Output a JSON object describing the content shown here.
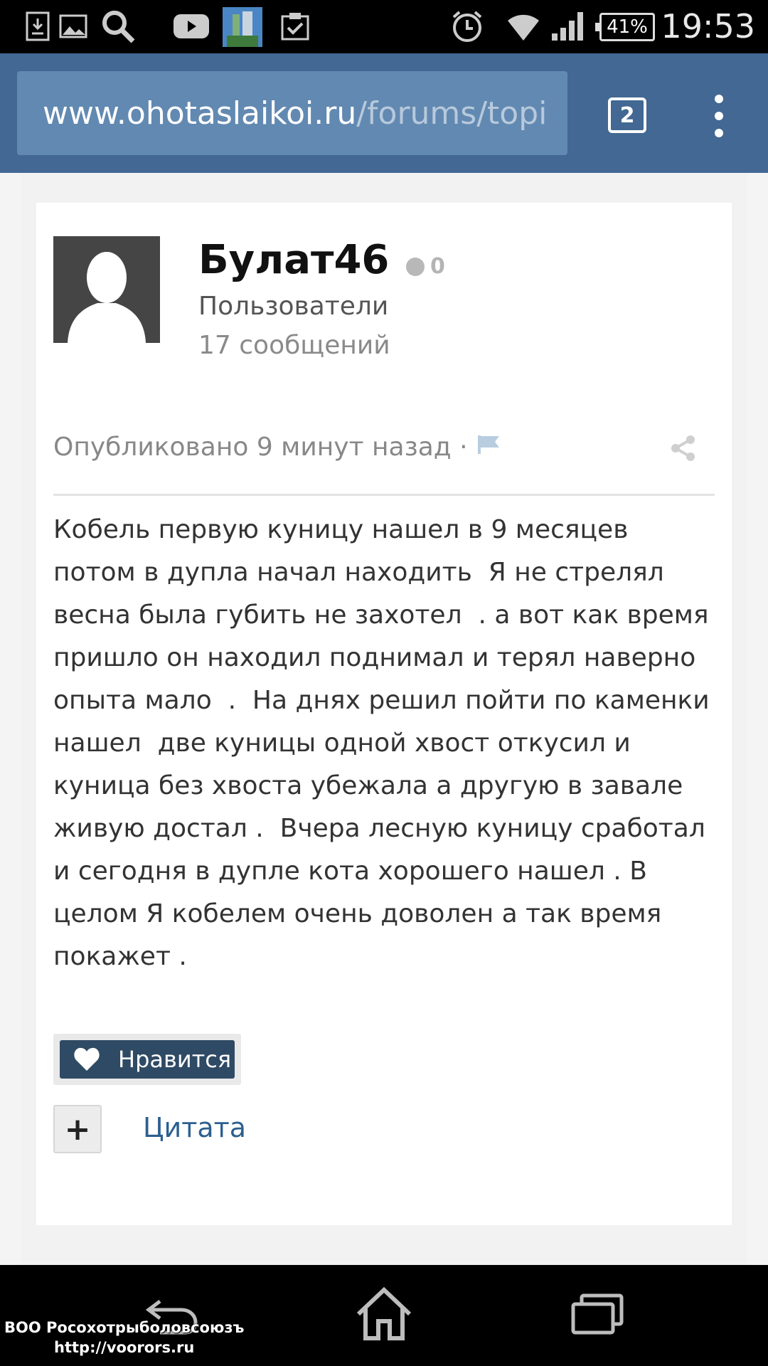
{
  "status_bar": {
    "icons": [
      "download-icon",
      "image-icon",
      "search-icon",
      "youtube-icon",
      "app-thumbnail-icon",
      "clipboard-check-icon",
      "alarm-icon",
      "wifi-icon",
      "signal-icon"
    ],
    "battery": "41%",
    "time": "19:53"
  },
  "browser": {
    "url_host": "www.ohotaslaikoi.ru",
    "url_path": "/forums/topi",
    "tab_count": "2"
  },
  "post": {
    "author": "Булат46",
    "reputation": "0",
    "group": "Пользователи",
    "post_count": "17 сообщений",
    "published": "Опубликовано 9 минут назад ·",
    "body_lines": [
      "Кобель первую куницу нашел в 9 месяцев",
      "потом в дупла начал находить  Я не стрелял",
      "весна была губить не захотел  . а вот как время",
      "пришло он находил поднимал и терял наверно",
      "опыта мало  .  На днях решил пойти по каменки",
      "нашел  две куницы одной хвост откусил и",
      "куница без хвоста убежала а другую в завале",
      "живую достал .  Вчера лесную куницу сработал",
      "и сегодня в дупле кота хорошего нашел . В",
      "целом Я кобелем очень доволен а так время",
      "покажет ."
    ],
    "like_label": "Нравится",
    "plus_label": "+",
    "quote_label": "Цитата"
  },
  "watermark": {
    "line1": "ВОО Росохотрыболовсоюзъ",
    "line2": "http://voorors.ru"
  },
  "colors": {
    "toolbar": "#426893",
    "url_box": "#6289b1",
    "like_button": "#2f4a64",
    "link": "#2d5f8f"
  }
}
